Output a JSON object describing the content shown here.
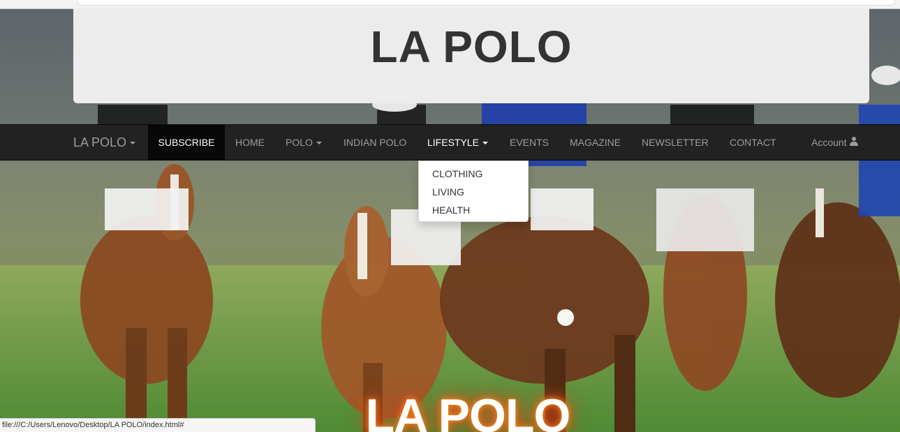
{
  "banner": {
    "title": "LA POLO"
  },
  "navbar": {
    "brand": "LA POLO",
    "items": [
      {
        "label": "SUBSCRIBE"
      },
      {
        "label": "HOME"
      },
      {
        "label": "POLO"
      },
      {
        "label": "INDIAN POLO"
      },
      {
        "label": "LIFESTYLE"
      },
      {
        "label": "EVENTS"
      },
      {
        "label": "MAGAZINE"
      },
      {
        "label": "NEWSLETTER"
      },
      {
        "label": "CONTACT"
      }
    ],
    "account": {
      "label": "Account",
      "icon": "user-icon"
    },
    "colors": {
      "bar": "#222222",
      "text": "#9d9d9d",
      "active": "#ffffff"
    }
  },
  "dropdown": {
    "parent": "LIFESTYLE",
    "items": [
      "CLOTHING",
      "LIVING",
      "HEALTH"
    ]
  },
  "hero": {
    "title": "LA POLO",
    "glow_color": "#f05a1e"
  },
  "status_bar": {
    "url": "file:///C:/Users/Lenovo/Desktop/LA POLO/index.html#"
  }
}
